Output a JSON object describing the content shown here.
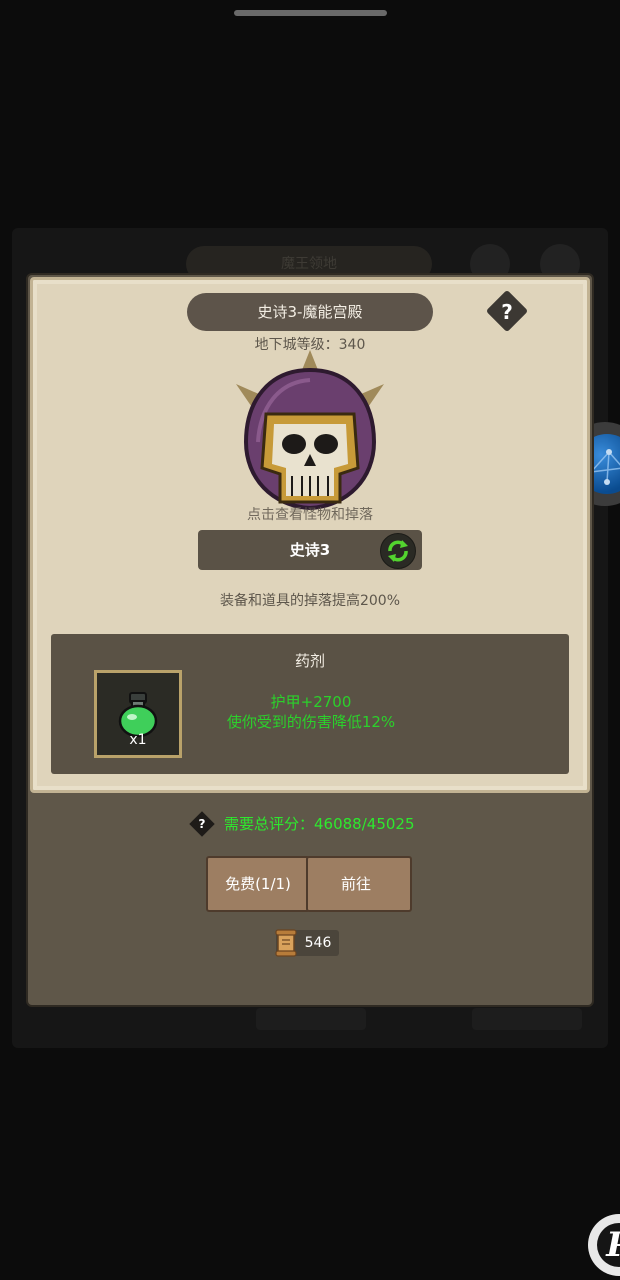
{
  "background": {
    "faded_title": "魔王领地"
  },
  "dungeon": {
    "title": "史诗3-魔能宫殿",
    "level_text": "地下城等级：340",
    "boss_hint": "点击查看怪物和掉落",
    "difficulty": "史诗3",
    "bonus_text": "装备和道具的掉落提高200%"
  },
  "help": {
    "label": "?"
  },
  "reward": {
    "title": "药剂",
    "item_icon": "green-potion-icon",
    "quantity": "x1",
    "effect_line1": "护甲+2700",
    "effect_line2": "使你受到的伤害降低12%"
  },
  "requirement": {
    "help_label": "?",
    "text": "需要总评分：46088/45025"
  },
  "actions": {
    "free_label": "免费(1/1)",
    "go_label": "前往"
  },
  "currency": {
    "icon": "scroll-icon",
    "value": "546"
  },
  "colors": {
    "parchment": "#dfd4bb",
    "panel": "#5a5245",
    "green_text": "#2bd12b",
    "wood": "#9d7e62"
  }
}
